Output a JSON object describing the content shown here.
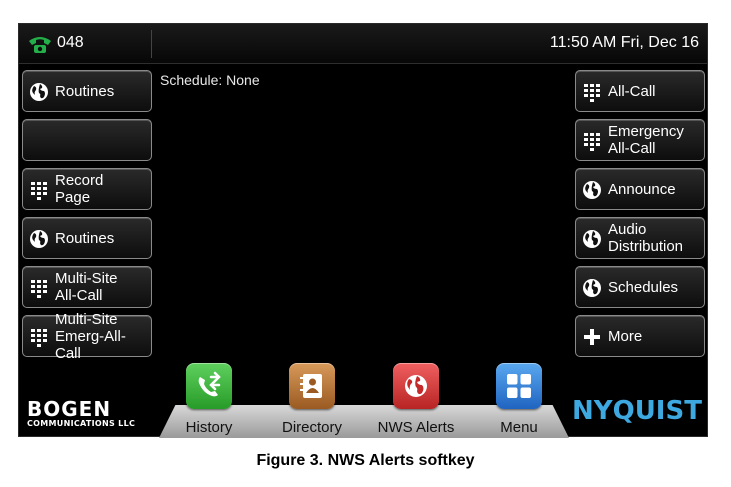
{
  "status": {
    "extension": "048",
    "clock": "11:50 AM Fri, Dec 16"
  },
  "main": {
    "schedule_text": "Schedule: None"
  },
  "left_softkeys": [
    {
      "label": "Routines",
      "icon": "globe-icon"
    },
    {
      "label": "",
      "icon": ""
    },
    {
      "label": "Record\nPage",
      "icon": "keypad-icon"
    },
    {
      "label": "Routines",
      "icon": "globe-icon"
    },
    {
      "label": "Multi-Site\nAll-Call",
      "icon": "keypad-icon"
    },
    {
      "label": "Multi-Site\nEmerg-All-Call",
      "icon": "keypad-icon"
    }
  ],
  "right_softkeys": [
    {
      "label": "All-Call",
      "icon": "keypad-icon"
    },
    {
      "label": "Emergency\nAll-Call",
      "icon": "keypad-icon"
    },
    {
      "label": "Announce",
      "icon": "globe-icon"
    },
    {
      "label": "Audio\nDistribution",
      "icon": "globe-icon"
    },
    {
      "label": "Schedules",
      "icon": "globe-icon"
    },
    {
      "label": "More",
      "icon": "plus-icon"
    }
  ],
  "dock": [
    {
      "label": "History",
      "icon": "history-phone-icon",
      "color": "#3aa83a"
    },
    {
      "label": "Directory",
      "icon": "address-book-icon",
      "color": "#b8743a"
    },
    {
      "label": "NWS Alerts",
      "icon": "nws-globe-icon",
      "color": "#d93a3a"
    },
    {
      "label": "Menu",
      "icon": "grid-icon",
      "color": "#2a7fd8"
    }
  ],
  "branding": {
    "left_logo_line1": "BOGEN",
    "left_logo_line2": "COMMUNICATIONS LLC",
    "right_logo": "NYQUIST",
    "right_logo_color": "#3ea8e0"
  },
  "caption": "Figure 3. NWS Alerts softkey"
}
